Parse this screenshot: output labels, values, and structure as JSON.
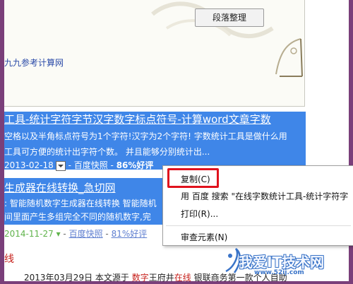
{
  "toolbar": {
    "paragraph_button": "段落整理"
  },
  "links": {
    "ninety_nine": "九九参考计算网"
  },
  "results": [
    {
      "title": "工具-统计字符字节汉字数字标点符号-计算word文章字数",
      "snippet_lines": [
        "空格以及半角标点符号为1个字符!汉字为2个字符! 字数统计工具是做什么用",
        "工具可方便的统计出字符个数。 并且能够分别统计出..."
      ],
      "date": "2013-02-18",
      "snapshot": "百度快照",
      "rating": "86%好评"
    },
    {
      "title": "生成器在线转换_急切网",
      "snippet_lines": [
        ": 智能随机数字生成器在线转换 智能随机",
        "间里面产生多组完全不同的随机数字,完"
      ],
      "date": "2014-11-27",
      "snapshot": "百度快照",
      "rating": "81%好评"
    }
  ],
  "red_mark": "线",
  "bottom_text": {
    "prefix": "2013年03月29日 本文源于 ",
    "word1": "数字",
    "mid": "王府井",
    "word2": "在线",
    "suffix": " 银联商务第一款个人自助"
  },
  "context_menu": {
    "items": [
      {
        "label": "复制(C)"
      },
      {
        "label": "用 百度 搜索 \"在线字数统计工具-统计字符字"
      },
      {
        "label": "打印(R)..."
      },
      {
        "label": "审查元素(N)"
      }
    ]
  },
  "watermark": {
    "text": "我爱IT技术网",
    "url": "www.52ij.com"
  },
  "colors": {
    "selection": "#3f86e8",
    "frame": "#7a3f7a",
    "highlight": "#e0121d"
  }
}
